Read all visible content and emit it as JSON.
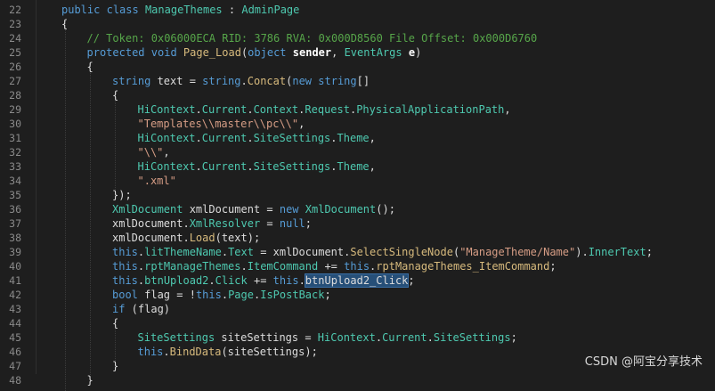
{
  "editor": {
    "lines": [
      {
        "n": "22",
        "i": 0,
        "t": [
          [
            "kw",
            "public"
          ],
          [
            "pl",
            " "
          ],
          [
            "kw",
            "class"
          ],
          [
            "pl",
            " "
          ],
          [
            "ty",
            "ManageThemes"
          ],
          [
            "pl",
            " : "
          ],
          [
            "ty",
            "AdminPage"
          ]
        ]
      },
      {
        "n": "23",
        "i": 0,
        "t": [
          [
            "pl",
            "{"
          ]
        ]
      },
      {
        "n": "24",
        "i": 1,
        "t": [
          [
            "cm",
            "// Token: 0x06000ECA RID: 3786 RVA: 0x000D8560 File Offset: 0x000D6760"
          ]
        ]
      },
      {
        "n": "25",
        "i": 1,
        "t": [
          [
            "kw",
            "protected"
          ],
          [
            "pl",
            " "
          ],
          [
            "kw",
            "void"
          ],
          [
            "pl",
            " "
          ],
          [
            "pr",
            "Page_Load"
          ],
          [
            "pl",
            "("
          ],
          [
            "kw",
            "object"
          ],
          [
            "pl",
            " "
          ],
          [
            "bd",
            "sender"
          ],
          [
            "pl",
            ", "
          ],
          [
            "ty",
            "EventArgs"
          ],
          [
            "pl",
            " "
          ],
          [
            "bd",
            "e"
          ],
          [
            "pl",
            ")"
          ]
        ]
      },
      {
        "n": "26",
        "i": 1,
        "t": [
          [
            "pl",
            "{"
          ]
        ]
      },
      {
        "n": "27",
        "i": 2,
        "t": [
          [
            "kw",
            "string"
          ],
          [
            "pl",
            " text = "
          ],
          [
            "kw",
            "string"
          ],
          [
            "pl",
            "."
          ],
          [
            "pr",
            "Concat"
          ],
          [
            "pl",
            "("
          ],
          [
            "kw",
            "new"
          ],
          [
            "pl",
            " "
          ],
          [
            "kw",
            "string"
          ],
          [
            "pl",
            "[]"
          ]
        ]
      },
      {
        "n": "28",
        "i": 2,
        "t": [
          [
            "pl",
            "{"
          ]
        ]
      },
      {
        "n": "29",
        "i": 3,
        "t": [
          [
            "ty",
            "HiContext"
          ],
          [
            "pl",
            "."
          ],
          [
            "ty",
            "Current"
          ],
          [
            "pl",
            "."
          ],
          [
            "ty",
            "Context"
          ],
          [
            "pl",
            "."
          ],
          [
            "ty",
            "Request"
          ],
          [
            "pl",
            "."
          ],
          [
            "ty",
            "PhysicalApplicationPath"
          ],
          [
            "pl",
            ","
          ]
        ]
      },
      {
        "n": "30",
        "i": 3,
        "t": [
          [
            "st",
            "\"Templates\\\\master\\\\pc\\\\\""
          ],
          [
            "pl",
            ","
          ]
        ]
      },
      {
        "n": "31",
        "i": 3,
        "t": [
          [
            "ty",
            "HiContext"
          ],
          [
            "pl",
            "."
          ],
          [
            "ty",
            "Current"
          ],
          [
            "pl",
            "."
          ],
          [
            "ty",
            "SiteSettings"
          ],
          [
            "pl",
            "."
          ],
          [
            "ty",
            "Theme"
          ],
          [
            "pl",
            ","
          ]
        ]
      },
      {
        "n": "32",
        "i": 3,
        "t": [
          [
            "st",
            "\"\\\\\""
          ],
          [
            "pl",
            ","
          ]
        ]
      },
      {
        "n": "33",
        "i": 3,
        "t": [
          [
            "ty",
            "HiContext"
          ],
          [
            "pl",
            "."
          ],
          [
            "ty",
            "Current"
          ],
          [
            "pl",
            "."
          ],
          [
            "ty",
            "SiteSettings"
          ],
          [
            "pl",
            "."
          ],
          [
            "ty",
            "Theme"
          ],
          [
            "pl",
            ","
          ]
        ]
      },
      {
        "n": "34",
        "i": 3,
        "t": [
          [
            "st",
            "\".xml\""
          ]
        ]
      },
      {
        "n": "35",
        "i": 2,
        "t": [
          [
            "pl",
            "});"
          ]
        ]
      },
      {
        "n": "36",
        "i": 2,
        "t": [
          [
            "ty",
            "XmlDocument"
          ],
          [
            "pl",
            " xmlDocument = "
          ],
          [
            "kw",
            "new"
          ],
          [
            "pl",
            " "
          ],
          [
            "ty",
            "XmlDocument"
          ],
          [
            "pl",
            "();"
          ]
        ]
      },
      {
        "n": "37",
        "i": 2,
        "t": [
          [
            "pl",
            "xmlDocument."
          ],
          [
            "ty",
            "XmlResolver"
          ],
          [
            "pl",
            " = "
          ],
          [
            "kw",
            "null"
          ],
          [
            "pl",
            ";"
          ]
        ]
      },
      {
        "n": "38",
        "i": 2,
        "t": [
          [
            "pl",
            "xmlDocument."
          ],
          [
            "pr",
            "Load"
          ],
          [
            "pl",
            "(text);"
          ]
        ]
      },
      {
        "n": "39",
        "i": 2,
        "t": [
          [
            "kw",
            "this"
          ],
          [
            "pl",
            "."
          ],
          [
            "ty",
            "litThemeName"
          ],
          [
            "pl",
            "."
          ],
          [
            "ty",
            "Text"
          ],
          [
            "pl",
            " = xmlDocument."
          ],
          [
            "pr",
            "SelectSingleNode"
          ],
          [
            "pl",
            "("
          ],
          [
            "st",
            "\"ManageTheme/Name\""
          ],
          [
            "pl",
            ")."
          ],
          [
            "ty",
            "InnerText"
          ],
          [
            "pl",
            ";"
          ]
        ]
      },
      {
        "n": "40",
        "i": 2,
        "t": [
          [
            "kw",
            "this"
          ],
          [
            "pl",
            "."
          ],
          [
            "ty",
            "rptManageThemes"
          ],
          [
            "pl",
            "."
          ],
          [
            "ty",
            "ItemCommand"
          ],
          [
            "pl",
            " += "
          ],
          [
            "kw",
            "this"
          ],
          [
            "pl",
            "."
          ],
          [
            "pr",
            "rptManageThemes_ItemCommand"
          ],
          [
            "pl",
            ";"
          ]
        ]
      },
      {
        "n": "41",
        "i": 2,
        "t": [
          [
            "kw",
            "this"
          ],
          [
            "pl",
            "."
          ],
          [
            "ty",
            "btnUpload2"
          ],
          [
            "pl",
            "."
          ],
          [
            "ty",
            "Click"
          ],
          [
            "pl",
            " += "
          ],
          [
            "kw",
            "this"
          ],
          [
            "pl",
            "."
          ],
          [
            "hl",
            "btnUpload2_Click"
          ],
          [
            "pl",
            ";"
          ]
        ]
      },
      {
        "n": "42",
        "i": 2,
        "t": [
          [
            "kw",
            "bool"
          ],
          [
            "pl",
            " flag = !"
          ],
          [
            "kw",
            "this"
          ],
          [
            "pl",
            "."
          ],
          [
            "ty",
            "Page"
          ],
          [
            "pl",
            "."
          ],
          [
            "ty",
            "IsPostBack"
          ],
          [
            "pl",
            ";"
          ]
        ]
      },
      {
        "n": "43",
        "i": 2,
        "t": [
          [
            "kw",
            "if"
          ],
          [
            "pl",
            " (flag)"
          ]
        ]
      },
      {
        "n": "44",
        "i": 2,
        "t": [
          [
            "pl",
            "{"
          ]
        ]
      },
      {
        "n": "45",
        "i": 3,
        "t": [
          [
            "ty",
            "SiteSettings"
          ],
          [
            "pl",
            " siteSettings = "
          ],
          [
            "ty",
            "HiContext"
          ],
          [
            "pl",
            "."
          ],
          [
            "ty",
            "Current"
          ],
          [
            "pl",
            "."
          ],
          [
            "ty",
            "SiteSettings"
          ],
          [
            "pl",
            ";"
          ]
        ]
      },
      {
        "n": "46",
        "i": 3,
        "t": [
          [
            "kw",
            "this"
          ],
          [
            "pl",
            "."
          ],
          [
            "pr",
            "BindData"
          ],
          [
            "pl",
            "(siteSettings);"
          ]
        ]
      },
      {
        "n": "47",
        "i": 2,
        "t": [
          [
            "pl",
            "}"
          ]
        ]
      },
      {
        "n": "48",
        "i": 1,
        "t": [
          [
            "pl",
            "}"
          ]
        ]
      }
    ]
  },
  "watermark": "CSDN @阿宝分享技术",
  "colors": {
    "background": "#1e1e1e",
    "keyword": "#569cd6",
    "type": "#4ec9b0",
    "method": "#d7ba7d",
    "comment": "#57a64a",
    "string": "#d69d85",
    "selection": "#264f78"
  }
}
